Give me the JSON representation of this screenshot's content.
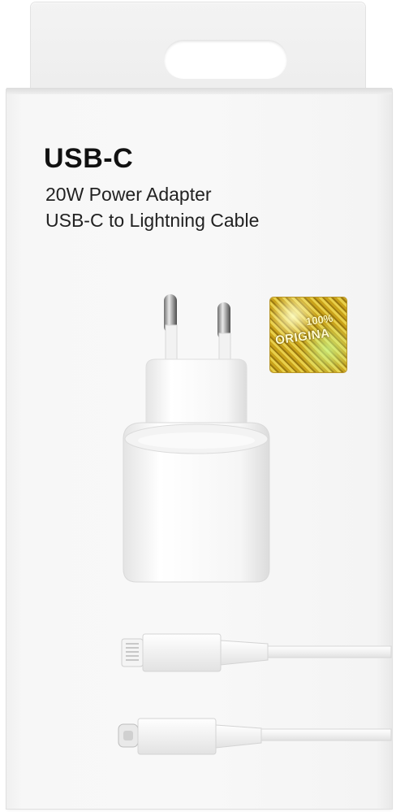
{
  "product": {
    "title": "USB-C",
    "line1": "20W Power Adapter",
    "line2": "USB-C to Lightning Cable"
  },
  "hologram_sticker": {
    "top_text": "100%",
    "main_text": "ORIGINA"
  },
  "colors": {
    "box": "#f7f7f7",
    "text": "#111111",
    "hologram_gold": "#d4b021"
  }
}
